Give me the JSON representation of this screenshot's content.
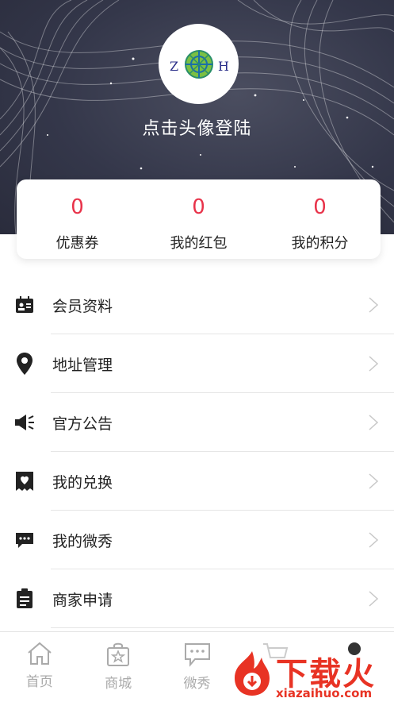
{
  "header": {
    "avatar_letters": [
      "Z",
      "H"
    ],
    "login_prompt": "点击头像登陆"
  },
  "stats": [
    {
      "value": "0",
      "label": "优惠券"
    },
    {
      "value": "0",
      "label": "我的红包"
    },
    {
      "value": "0",
      "label": "我的积分"
    }
  ],
  "menu": [
    {
      "label": "会员资料",
      "icon": "member-card-icon"
    },
    {
      "label": "地址管理",
      "icon": "location-pin-icon"
    },
    {
      "label": "官方公告",
      "icon": "megaphone-icon"
    },
    {
      "label": "我的兑换",
      "icon": "heart-tag-icon"
    },
    {
      "label": "我的微秀",
      "icon": "chat-bubble-icon"
    },
    {
      "label": "商家申请",
      "icon": "clipboard-icon"
    }
  ],
  "tabbar": [
    {
      "label": "首页",
      "icon": "home-icon"
    },
    {
      "label": "商城",
      "icon": "shopping-bag-icon"
    },
    {
      "label": "微秀",
      "icon": "chat-icon"
    },
    {
      "label": "",
      "icon": "cart-icon"
    },
    {
      "label": "",
      "icon": "profile-icon"
    }
  ],
  "watermark": {
    "text": "下载火",
    "sub": "xiazaihuo.com"
  },
  "colors": {
    "accent": "#e8334a",
    "header_bg": "#34374a",
    "watermark": "#e83324"
  }
}
